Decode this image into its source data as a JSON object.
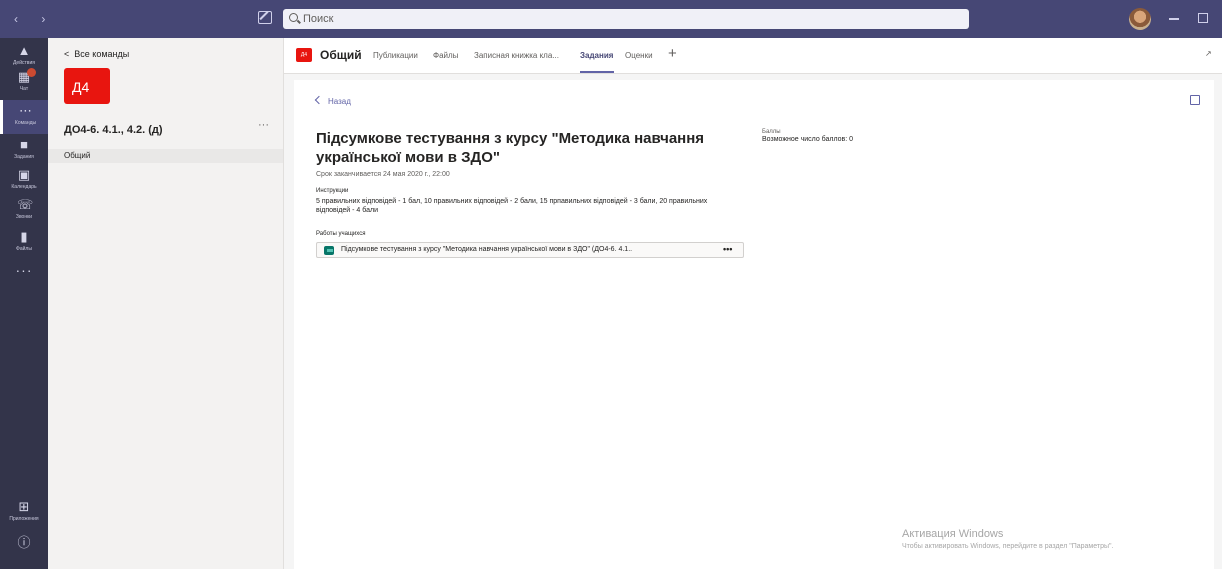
{
  "topbar": {
    "search_placeholder": "Поиск",
    "nav_arrows": "‹ ›"
  },
  "rail": {
    "items": [
      {
        "label": "Действия",
        "icon": "bell-icon"
      },
      {
        "label": "Чат",
        "icon": "chat-icon"
      },
      {
        "label": "Команды",
        "icon": "teams-icon"
      },
      {
        "label": "Задания",
        "icon": "assignments-icon"
      },
      {
        "label": "Календарь",
        "icon": "calendar-icon"
      },
      {
        "label": "Звонки",
        "icon": "phone-icon"
      },
      {
        "label": "Файлы",
        "icon": "files-icon"
      }
    ],
    "more": "···",
    "apps_label": "Приложения",
    "help_icon": "help-icon"
  },
  "teampane": {
    "back_label": "Все команды",
    "team_avatar": "Д4",
    "team_name": "ДО4-6. 4.1., 4.2. (д)",
    "more": "···",
    "channel": "Общий"
  },
  "channel_header": {
    "badge": "Д4",
    "title": "Общий",
    "tabs": [
      "Публикации",
      "Файлы",
      "Записная книжка кла...",
      "Задания",
      "Оценки"
    ],
    "active_tab": "Задания",
    "add": "+"
  },
  "assignment": {
    "back_label": "Назад",
    "title": "Підсумкове тестування з курсу \"Методика навчання української мови в ЗДО\"",
    "due": "Срок заканчивается 24 мая 2020 г., 22:00",
    "instructions_heading": "Инструкции",
    "instructions": "5 правильних відповідей - 1 бал, 10 правильних відповідей - 2 бали, 15 прпавильних відповідей - 3 бали, 20 правильних відповідей - 4 бали",
    "student_work_heading": "Работы учащихся",
    "student_work_item": "Підсумкове тестування з курсу \"Методика навчання української мови в ЗДО\" (ДО4-6. 4.1..",
    "student_work_more": "•••",
    "points_heading": "Баллы",
    "points_value": "Возможное число баллов: 0"
  },
  "watermark": {
    "line1": "Активация Windows",
    "line2": "Чтобы активировать Windows, перейдите в раздел \"Параметры\"."
  },
  "colors": {
    "topbar": "#464775",
    "rail": "#33344a",
    "accent": "#6264a7",
    "team_red": "#e8150f"
  }
}
